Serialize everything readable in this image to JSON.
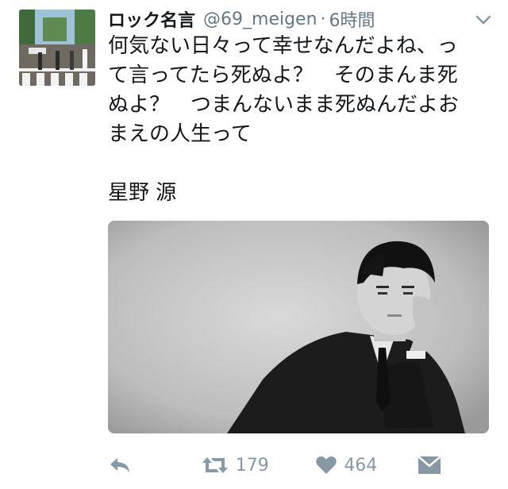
{
  "tweet": {
    "account_name": "ロック名言",
    "handle": "@69_meigen",
    "separator": "·",
    "time": "6時間",
    "text_lines": [
      "何気ない日々って幸せなんだよね、っ",
      "て言ってたら死ぬよ？　そのまんま死",
      "ぬよ？　つまんないまま死ぬんだよお",
      "まえの人生って"
    ],
    "attribution": "星野 源",
    "stats": {
      "retweets": "179",
      "likes": "464"
    }
  },
  "icons": {
    "caret": "chevron-down-icon",
    "reply": "reply-icon",
    "retweet": "retweet-icon",
    "like": "heart-icon",
    "dm": "envelope-icon"
  },
  "colors": {
    "text": "#14171a",
    "muted": "#657786",
    "action_gray": "#8899a6"
  }
}
